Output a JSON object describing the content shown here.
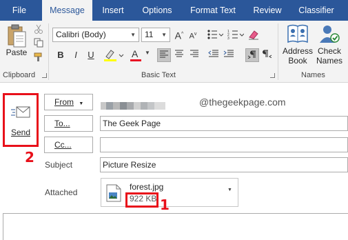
{
  "tabs": [
    {
      "label": "File",
      "active": false
    },
    {
      "label": "Message",
      "active": true
    },
    {
      "label": "Insert",
      "active": false
    },
    {
      "label": "Options",
      "active": false
    },
    {
      "label": "Format Text",
      "active": false
    },
    {
      "label": "Review",
      "active": false
    },
    {
      "label": "Classifier",
      "active": false
    }
  ],
  "ribbon": {
    "clipboard": {
      "paste_label": "Paste",
      "group_label": "Clipboard"
    },
    "basic_text": {
      "font_name": "Calibri (Body)",
      "font_size": "11",
      "group_label": "Basic Text",
      "bold": "B",
      "italic": "I",
      "underline": "U",
      "font_color_letter": "A",
      "grow_font": "A",
      "shrink_font": "A"
    },
    "names": {
      "address_book_label": "Address Book",
      "check_names_label": "Check Names",
      "group_label": "Names"
    }
  },
  "compose": {
    "send_label": "Send",
    "from_label": "From",
    "to_label": "To...",
    "cc_label": "Cc...",
    "to_value": "The Geek Page",
    "cc_value": "",
    "subject_label": "Subject",
    "subject_value": "Picture Resize",
    "attached_label": "Attached",
    "attachment": {
      "name": "forest.jpg",
      "size": "922 KB"
    },
    "watermark": "@thegeekpage.com"
  },
  "annotations": {
    "send_step": "2",
    "size_step": "1"
  },
  "colors": {
    "ribbon_blue": "#2b579a",
    "annotation_red": "#e8101a"
  }
}
